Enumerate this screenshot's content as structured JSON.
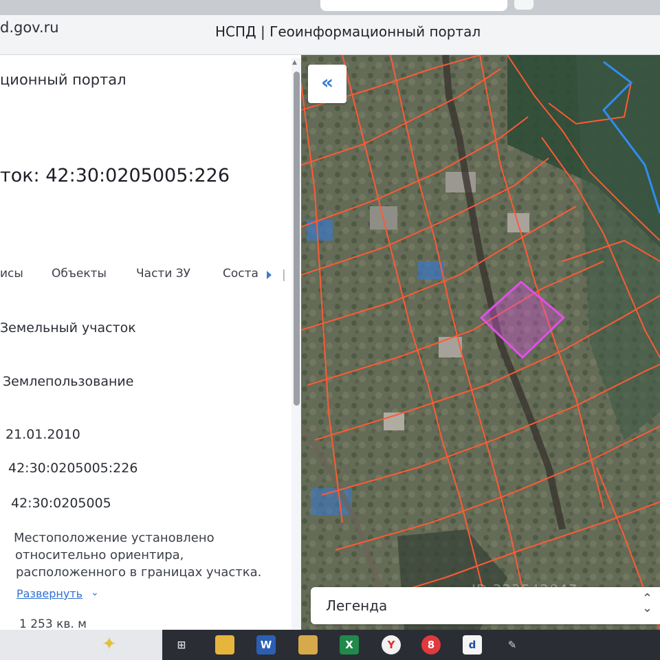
{
  "browser": {
    "url_fragment": "d.gov.ru",
    "page_title": "НСПД | Геоинформационный портал"
  },
  "panel": {
    "portal_subtitle": "ционный портал",
    "parcel_title": "ток: 42:30:0205005:226",
    "tabs": [
      "исы",
      "Объекты",
      "Части ЗУ",
      "Соста"
    ],
    "fields": {
      "object_type": "Земельный участок",
      "land_use_kind": "Землепользование",
      "date": "21.01.2010",
      "cad_number": "42:30:0205005:226",
      "cad_quarter": "42:30:0205005",
      "location_lines": [
        "Местоположение установлено",
        "относительно ориентира,",
        "расположенного в границах участка."
      ],
      "expand_link": "Развернуть",
      "area": "1 253 кв. м"
    }
  },
  "map": {
    "collapse_glyph": "«",
    "legend_label": "Легенда",
    "watermark": "ID 323542847",
    "parcel_line_color": "#ff5a36",
    "selected_parcel_color": "#e050e8",
    "boundary_color": "#2f8df0"
  },
  "taskbar": {
    "icons": [
      "task-view-icon",
      "file-explorer-icon",
      "word-icon",
      "folder-icon",
      "excel-icon",
      "yandex-browser-icon",
      "app-icon",
      "app-d-icon",
      "app-pen-icon"
    ]
  }
}
